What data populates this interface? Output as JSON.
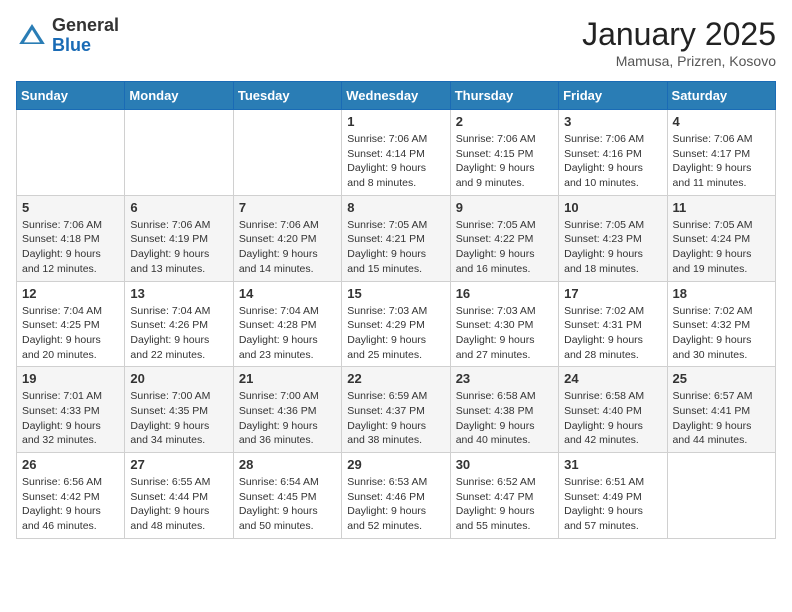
{
  "header": {
    "logo_general": "General",
    "logo_blue": "Blue",
    "month_title": "January 2025",
    "location": "Mamusa, Prizren, Kosovo"
  },
  "weekdays": [
    "Sunday",
    "Monday",
    "Tuesday",
    "Wednesday",
    "Thursday",
    "Friday",
    "Saturday"
  ],
  "weeks": [
    [
      {
        "day": "",
        "info": ""
      },
      {
        "day": "",
        "info": ""
      },
      {
        "day": "",
        "info": ""
      },
      {
        "day": "1",
        "info": "Sunrise: 7:06 AM\nSunset: 4:14 PM\nDaylight: 9 hours and 8 minutes."
      },
      {
        "day": "2",
        "info": "Sunrise: 7:06 AM\nSunset: 4:15 PM\nDaylight: 9 hours and 9 minutes."
      },
      {
        "day": "3",
        "info": "Sunrise: 7:06 AM\nSunset: 4:16 PM\nDaylight: 9 hours and 10 minutes."
      },
      {
        "day": "4",
        "info": "Sunrise: 7:06 AM\nSunset: 4:17 PM\nDaylight: 9 hours and 11 minutes."
      }
    ],
    [
      {
        "day": "5",
        "info": "Sunrise: 7:06 AM\nSunset: 4:18 PM\nDaylight: 9 hours and 12 minutes."
      },
      {
        "day": "6",
        "info": "Sunrise: 7:06 AM\nSunset: 4:19 PM\nDaylight: 9 hours and 13 minutes."
      },
      {
        "day": "7",
        "info": "Sunrise: 7:06 AM\nSunset: 4:20 PM\nDaylight: 9 hours and 14 minutes."
      },
      {
        "day": "8",
        "info": "Sunrise: 7:05 AM\nSunset: 4:21 PM\nDaylight: 9 hours and 15 minutes."
      },
      {
        "day": "9",
        "info": "Sunrise: 7:05 AM\nSunset: 4:22 PM\nDaylight: 9 hours and 16 minutes."
      },
      {
        "day": "10",
        "info": "Sunrise: 7:05 AM\nSunset: 4:23 PM\nDaylight: 9 hours and 18 minutes."
      },
      {
        "day": "11",
        "info": "Sunrise: 7:05 AM\nSunset: 4:24 PM\nDaylight: 9 hours and 19 minutes."
      }
    ],
    [
      {
        "day": "12",
        "info": "Sunrise: 7:04 AM\nSunset: 4:25 PM\nDaylight: 9 hours and 20 minutes."
      },
      {
        "day": "13",
        "info": "Sunrise: 7:04 AM\nSunset: 4:26 PM\nDaylight: 9 hours and 22 minutes."
      },
      {
        "day": "14",
        "info": "Sunrise: 7:04 AM\nSunset: 4:28 PM\nDaylight: 9 hours and 23 minutes."
      },
      {
        "day": "15",
        "info": "Sunrise: 7:03 AM\nSunset: 4:29 PM\nDaylight: 9 hours and 25 minutes."
      },
      {
        "day": "16",
        "info": "Sunrise: 7:03 AM\nSunset: 4:30 PM\nDaylight: 9 hours and 27 minutes."
      },
      {
        "day": "17",
        "info": "Sunrise: 7:02 AM\nSunset: 4:31 PM\nDaylight: 9 hours and 28 minutes."
      },
      {
        "day": "18",
        "info": "Sunrise: 7:02 AM\nSunset: 4:32 PM\nDaylight: 9 hours and 30 minutes."
      }
    ],
    [
      {
        "day": "19",
        "info": "Sunrise: 7:01 AM\nSunset: 4:33 PM\nDaylight: 9 hours and 32 minutes."
      },
      {
        "day": "20",
        "info": "Sunrise: 7:00 AM\nSunset: 4:35 PM\nDaylight: 9 hours and 34 minutes."
      },
      {
        "day": "21",
        "info": "Sunrise: 7:00 AM\nSunset: 4:36 PM\nDaylight: 9 hours and 36 minutes."
      },
      {
        "day": "22",
        "info": "Sunrise: 6:59 AM\nSunset: 4:37 PM\nDaylight: 9 hours and 38 minutes."
      },
      {
        "day": "23",
        "info": "Sunrise: 6:58 AM\nSunset: 4:38 PM\nDaylight: 9 hours and 40 minutes."
      },
      {
        "day": "24",
        "info": "Sunrise: 6:58 AM\nSunset: 4:40 PM\nDaylight: 9 hours and 42 minutes."
      },
      {
        "day": "25",
        "info": "Sunrise: 6:57 AM\nSunset: 4:41 PM\nDaylight: 9 hours and 44 minutes."
      }
    ],
    [
      {
        "day": "26",
        "info": "Sunrise: 6:56 AM\nSunset: 4:42 PM\nDaylight: 9 hours and 46 minutes."
      },
      {
        "day": "27",
        "info": "Sunrise: 6:55 AM\nSunset: 4:44 PM\nDaylight: 9 hours and 48 minutes."
      },
      {
        "day": "28",
        "info": "Sunrise: 6:54 AM\nSunset: 4:45 PM\nDaylight: 9 hours and 50 minutes."
      },
      {
        "day": "29",
        "info": "Sunrise: 6:53 AM\nSunset: 4:46 PM\nDaylight: 9 hours and 52 minutes."
      },
      {
        "day": "30",
        "info": "Sunrise: 6:52 AM\nSunset: 4:47 PM\nDaylight: 9 hours and 55 minutes."
      },
      {
        "day": "31",
        "info": "Sunrise: 6:51 AM\nSunset: 4:49 PM\nDaylight: 9 hours and 57 minutes."
      },
      {
        "day": "",
        "info": ""
      }
    ]
  ]
}
